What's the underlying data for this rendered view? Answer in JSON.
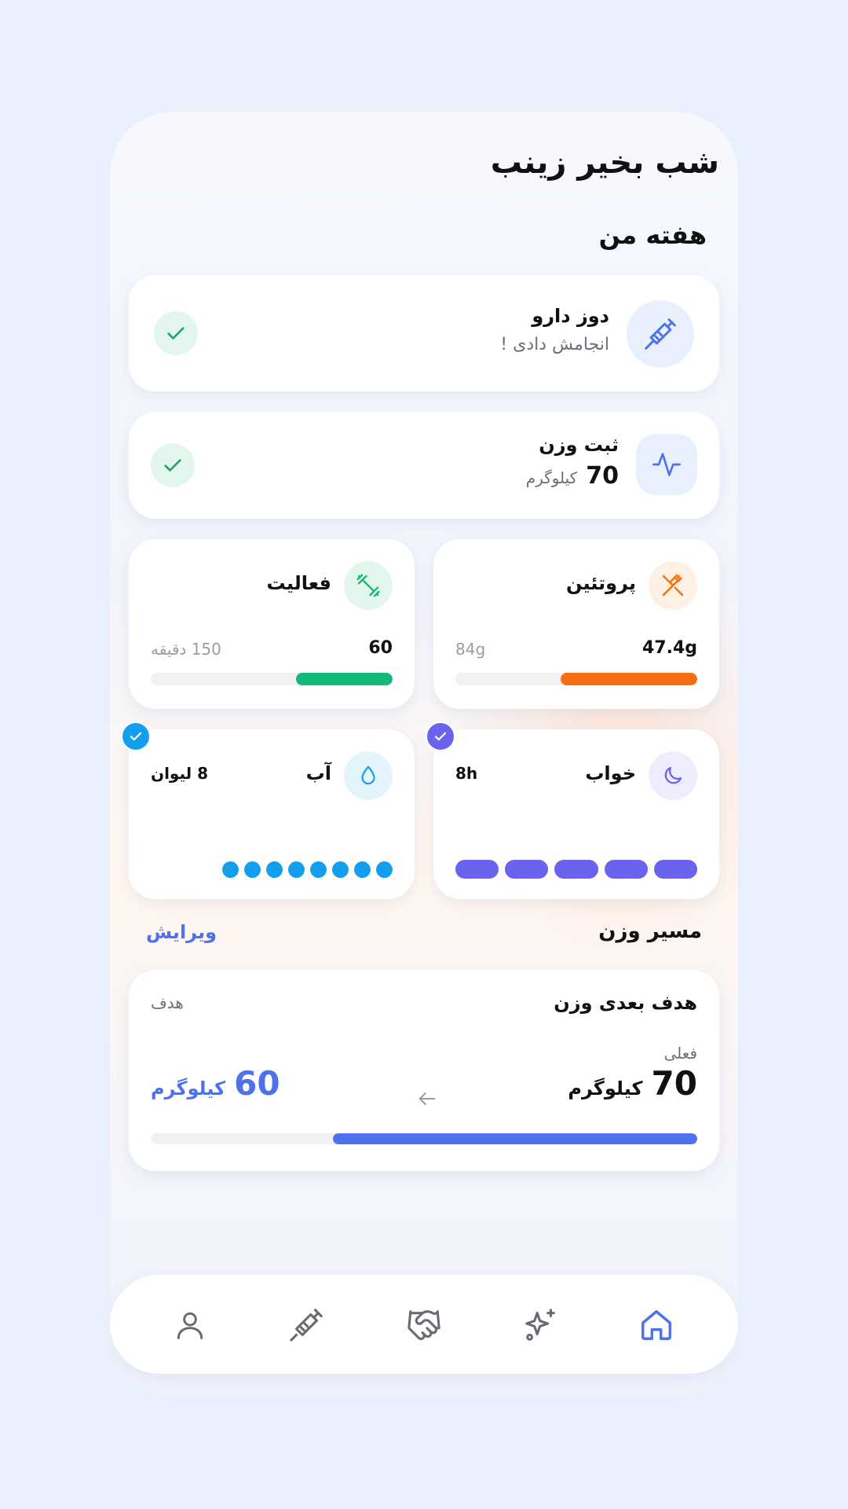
{
  "greeting": "شب بخیر زینب",
  "week_title": "هفته من",
  "medication": {
    "title": "دوز دارو",
    "subtitle": "انجامش دادی !",
    "icon": "syringe-icon",
    "done": true
  },
  "weight_log": {
    "title": "ثبت وزن",
    "value": "70",
    "unit": "کیلوگرم",
    "icon": "pulse-icon",
    "done": true
  },
  "protein": {
    "title": "پروتئین",
    "current": "47.4g",
    "target": "84g",
    "progress": 0.564,
    "color": "#f76e11",
    "icon": "fork-knife-icon"
  },
  "activity": {
    "title": "فعالیت",
    "current": "60",
    "target": "150 دقیقه",
    "progress": 0.4,
    "color": "#13b87a",
    "icon": "dumbbell-icon"
  },
  "sleep": {
    "title": "خواب",
    "value": "8h",
    "segments": 5,
    "color": "#6a63f0",
    "icon": "moon-icon"
  },
  "water": {
    "title": "آب",
    "value": "8 لیوان",
    "dots": 8,
    "color": "#12a0ee",
    "icon": "water-drop-icon"
  },
  "weight_path": {
    "title": "مسیر وزن",
    "edit_label": "ویرایش"
  },
  "goal_card": {
    "title": "هدف بعدی وزن",
    "goal_label": "هدف",
    "current_label": "فعلی",
    "current_value": "70",
    "current_unit": "کیلوگرم",
    "goal_value": "60",
    "goal_unit": "کیلوگرم",
    "progress": 0.667,
    "accent": "#4f72ec"
  },
  "nav": {
    "items": [
      "home-icon",
      "sparkles-icon",
      "handshake-icon",
      "syringe-icon",
      "user-icon"
    ],
    "active": "home-icon"
  }
}
